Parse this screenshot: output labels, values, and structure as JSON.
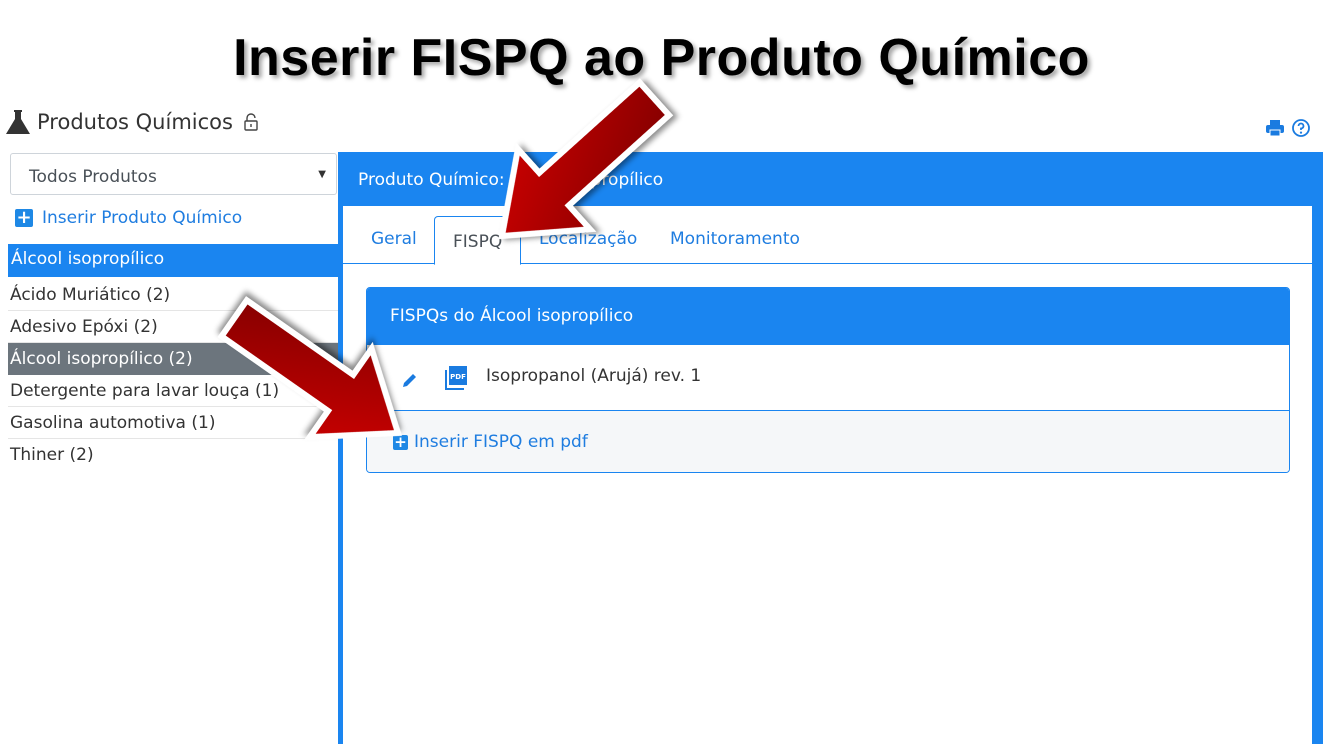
{
  "slide": {
    "title": "Inserir FISPQ ao Produto Químico"
  },
  "header": {
    "title": "Produtos Químicos"
  },
  "sidebar": {
    "filter_value": "Todos Produtos",
    "add_label": "Inserir Produto Químico",
    "selected_label": "Álcool isopropílico",
    "items": [
      {
        "label": "Ácido Muriático (2)"
      },
      {
        "label": "Adesivo Epóxi (2)"
      },
      {
        "label": "Álcool isopropílico (2)"
      },
      {
        "label": "Detergente para lavar louça (1)"
      },
      {
        "label": "Gasolina automotiva (1)"
      },
      {
        "label": "Thiner (2)"
      }
    ]
  },
  "panel": {
    "heading": "Produto Químico: Álcool isopropílico",
    "tabs": [
      {
        "label": "Geral"
      },
      {
        "label": "FISPQ"
      },
      {
        "label": "Localização"
      },
      {
        "label": "Monitoramento"
      }
    ],
    "card": {
      "title": "FISPQs do Álcool isopropílico",
      "file": "Isopropanol (Arujá) rev. 1",
      "add_label": "Inserir FISPQ em pdf"
    }
  },
  "colors": {
    "primary": "#1a85f0",
    "link": "#1f7de0",
    "active_item": "#6c757d",
    "arrow": "#b00000"
  },
  "icons": [
    "flask-icon",
    "lock-icon",
    "print-icon",
    "help-icon",
    "plus-icon",
    "edit-icon",
    "pdf-icon",
    "arrow-annotation"
  ]
}
